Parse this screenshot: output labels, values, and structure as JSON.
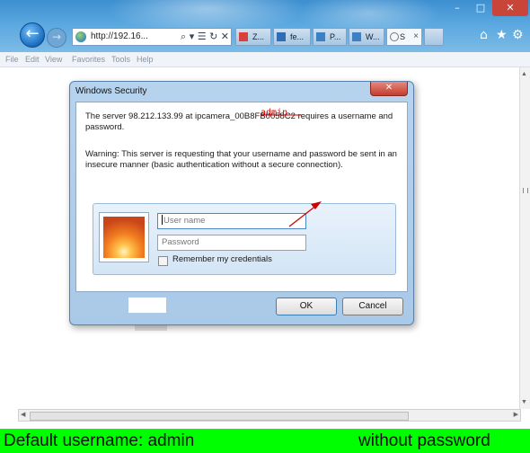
{
  "browser": {
    "address": "http://192.16...",
    "address_tools": "⌕ ▾ ☰ ↻ ✕",
    "tabs": [
      {
        "label": "Z..."
      },
      {
        "label": "fe..."
      },
      {
        "label": "P..."
      },
      {
        "label": "W..."
      },
      {
        "label": "S",
        "active": true
      }
    ],
    "window_controls": {
      "minimize": "–",
      "maximize": "□",
      "close": "✕"
    },
    "toolbar_icons": [
      "home-icon",
      "star-icon",
      "gear-icon"
    ],
    "menu": [
      "File",
      "Edit",
      "View",
      "Favorites",
      "Tools",
      "Help"
    ]
  },
  "dialog": {
    "title": "Windows Security",
    "close_label": "✕",
    "server_message": "The server 98.212.133.99 at ipcamera_00B8FB0058C2 requires a username and password.",
    "warning_message": "Warning: This server is requesting that your username and password be sent in an insecure manner (basic authentication without a secure connection).",
    "username_placeholder": "User name",
    "password_placeholder": "Password",
    "remember_label": "Remember my credentials",
    "remember_checked": false,
    "ok_label": "OK",
    "cancel_label": "Cancel"
  },
  "annotation": {
    "text": "admin",
    "color": "#d20000"
  },
  "caption": {
    "left": "Default username: admin",
    "right": "without password",
    "background": "#00ff00"
  }
}
